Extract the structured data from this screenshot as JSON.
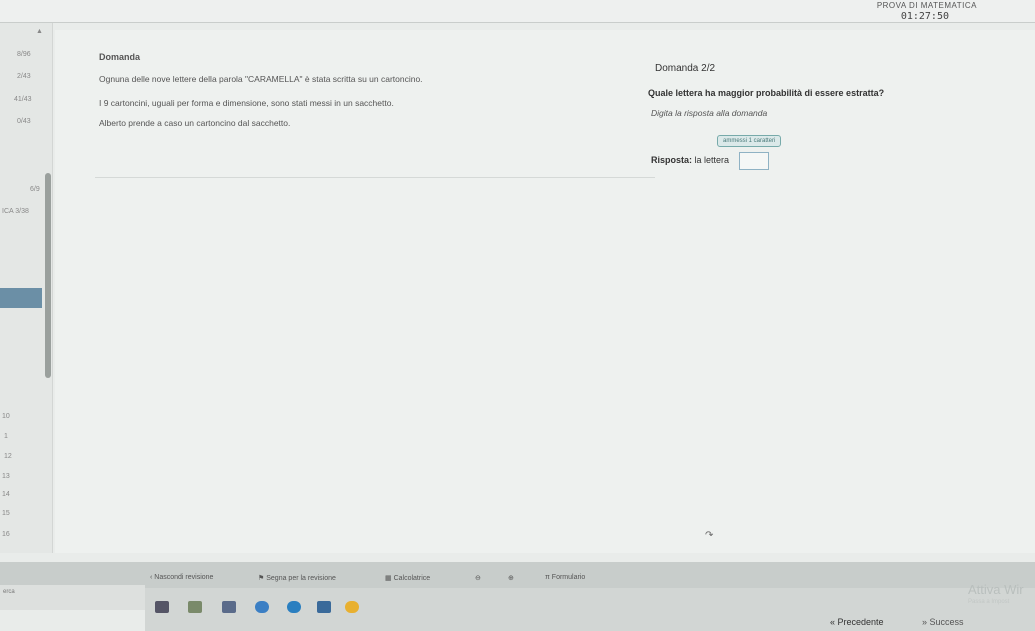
{
  "header": {
    "exam_title": "PROVA DI MATEMATICA",
    "timer": "01:27:50"
  },
  "left_panel": {
    "rows": [
      "8/96",
      "2/43",
      "41/43",
      "0/43",
      "6/9",
      "ICA 3/38",
      "10",
      "1",
      "12",
      "13",
      "14",
      "15",
      "16"
    ]
  },
  "question": {
    "heading": "Domanda",
    "line1": "Ognuna delle nove lettere della parola \"CARAMELLA\" è stata scritta su un cartoncino.",
    "line2": "I 9 cartoncini, uguali per forma e dimensione, sono stati messi in un sacchetto.",
    "line3": "Alberto prende a caso un cartoncino dal sacchetto.",
    "number": "Domanda 2/2",
    "text": "Quale lettera ha maggior probabilità di essere estratta?",
    "hint": "Digita la risposta alla domanda",
    "chip": "ammessi 1 caratteri",
    "answer_label": "Risposta:",
    "answer_suffix": "la lettera",
    "answer_value": ""
  },
  "review_bar": {
    "hide_review": "Nascondi revisione",
    "mark_review": "Segna per la revisione",
    "calculator": "Calcolatrice",
    "formulas": "Formulario",
    "left_input": "erca"
  },
  "navigation": {
    "prev": "Precedente",
    "next": "Success"
  },
  "watermark": {
    "title": "Attiva Wir",
    "subtitle": "Passa a Impost"
  },
  "colors": {
    "accent": "#6b8fa6",
    "answer_border": "#8fb2c4"
  }
}
